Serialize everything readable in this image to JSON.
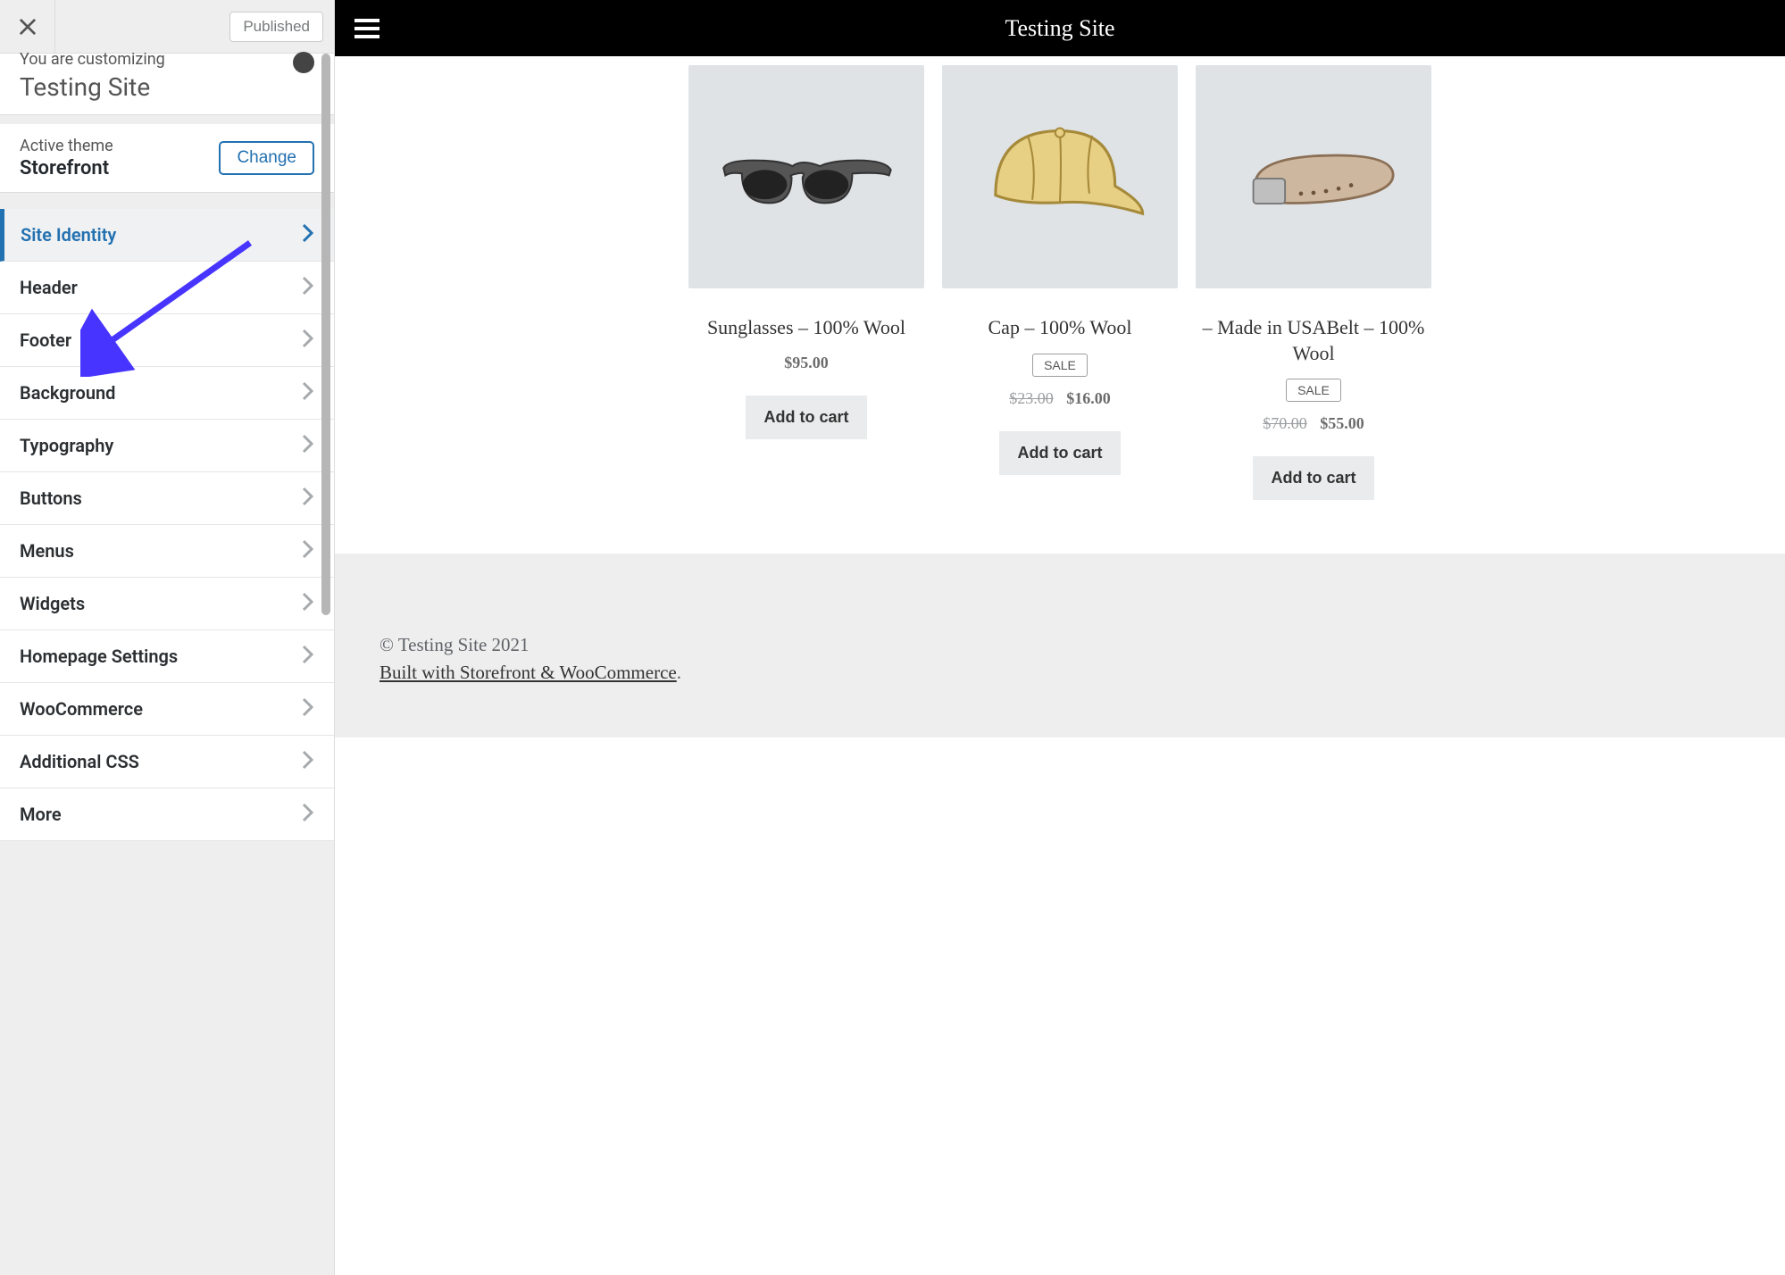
{
  "topbar": {
    "publish_label": "Published"
  },
  "customizer": {
    "prefix": "You are customizing",
    "site_name": "Testing Site",
    "active_theme_label": "Active theme",
    "theme_name": "Storefront",
    "change_label": "Change"
  },
  "menu": {
    "items": [
      {
        "label": "Site Identity",
        "active": true
      },
      {
        "label": "Header"
      },
      {
        "label": "Footer"
      },
      {
        "label": "Background"
      },
      {
        "label": "Typography"
      },
      {
        "label": "Buttons"
      },
      {
        "label": "Menus"
      },
      {
        "label": "Widgets"
      },
      {
        "label": "Homepage Settings"
      },
      {
        "label": "WooCommerce"
      },
      {
        "label": "Additional CSS"
      },
      {
        "label": "More"
      }
    ]
  },
  "preview": {
    "site_title": "Testing Site",
    "products": [
      {
        "title": "Sunglasses – 100% Wool",
        "price": "$95.00",
        "add_label": "Add to cart",
        "sale": false,
        "original_price": "",
        "icon": "sunglasses"
      },
      {
        "title": "Cap – 100% Wool",
        "price": "$16.00",
        "original_price": "$23.00",
        "add_label": "Add to cart",
        "sale": true,
        "sale_label": "SALE",
        "icon": "cap"
      },
      {
        "title": "– Made in USABelt – 100% Wool",
        "price": "$55.00",
        "original_price": "$70.00",
        "add_label": "Add to cart",
        "sale": true,
        "sale_label": "SALE",
        "icon": "belt"
      }
    ],
    "footer": {
      "copyright": "© Testing Site 2021",
      "credit_text": "Built with Storefront & WooCommerce",
      "credit_suffix": "."
    }
  }
}
